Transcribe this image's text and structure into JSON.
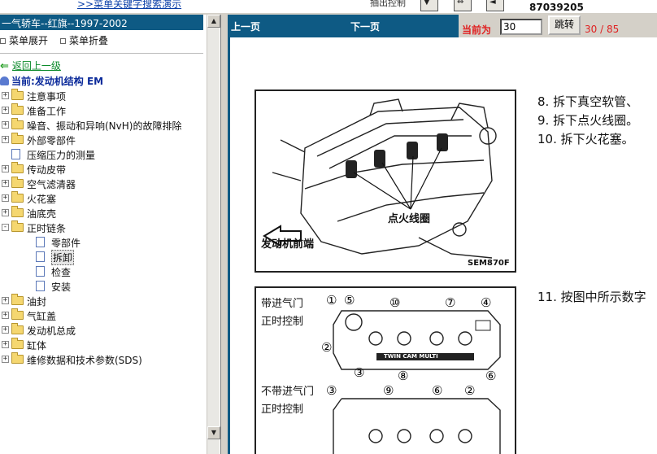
{
  "top_strip": {
    "link_text": ">>菜单关键字搜索演示",
    "mid_text": "抽出控制",
    "number": "87039205"
  },
  "left_panel": {
    "title": "一气轿车--红旗--1997-2002",
    "expand_all": "菜单展开",
    "collapse_all": "菜单折叠",
    "back_link": "返回上一级",
    "current_label": "当前:发动机结构  EM",
    "tree": [
      {
        "label": "注意事项",
        "type": "folder",
        "expander": "+"
      },
      {
        "label": "准备工作",
        "type": "folder",
        "expander": "+"
      },
      {
        "label": "噪音、振动和异响(NvH)的故障排除",
        "type": "folder",
        "expander": "+"
      },
      {
        "label": "外部零部件",
        "type": "folder",
        "expander": "+"
      },
      {
        "label": "压缩压力的测量",
        "type": "doc",
        "expander": ""
      },
      {
        "label": "传动皮带",
        "type": "folder",
        "expander": "+"
      },
      {
        "label": "空气滤清器",
        "type": "folder",
        "expander": "+"
      },
      {
        "label": "火花塞",
        "type": "folder",
        "expander": "+"
      },
      {
        "label": "油底壳",
        "type": "folder",
        "expander": "+"
      },
      {
        "label": "正时链条",
        "type": "folder",
        "expander": "-"
      },
      {
        "label": "零部件",
        "type": "doc",
        "expander": "",
        "child": true
      },
      {
        "label": "拆卸",
        "type": "doc",
        "expander": "",
        "child": true,
        "selected": true
      },
      {
        "label": "检查",
        "type": "doc",
        "expander": "",
        "child": true
      },
      {
        "label": "安装",
        "type": "doc",
        "expander": "",
        "child": true
      },
      {
        "label": "油封",
        "type": "folder",
        "expander": "+"
      },
      {
        "label": "气缸盖",
        "type": "folder",
        "expander": "+"
      },
      {
        "label": "发动机总成",
        "type": "folder",
        "expander": "+"
      },
      {
        "label": "缸体",
        "type": "folder",
        "expander": "+"
      },
      {
        "label": "维修数据和技术参数(SDS)",
        "type": "folder",
        "expander": "+"
      }
    ]
  },
  "nav": {
    "prev_label": "上一页",
    "next_label": "下一页",
    "current_label": "当前为",
    "page_value": "30",
    "jump_label": "跳转",
    "page_count": "30 / 85"
  },
  "content": {
    "steps": [
      "8.  拆下真空软管、",
      "9.  拆下点火线圈。",
      "10. 拆下火花塞。",
      "11. 按图中所示数字"
    ],
    "fig1": {
      "callout": "点火线圈",
      "front_label": "发动机前端",
      "code": "SEM870F"
    },
    "fig2": {
      "label_with_1": "带进气门",
      "label_with_2": "正时控制",
      "label_without_1": "不带进气门",
      "label_without_2": "正时控制",
      "cover_text": "TWIN CAM MULTI",
      "nums_top": [
        "①",
        "⑤",
        "⑩",
        "⑦",
        "④"
      ],
      "nums_left": [
        "②"
      ],
      "nums_bot_row": [
        "③",
        "⑧",
        "⑥"
      ],
      "nums_b_top": [
        "③",
        "⑨",
        "⑥",
        "②"
      ]
    }
  }
}
